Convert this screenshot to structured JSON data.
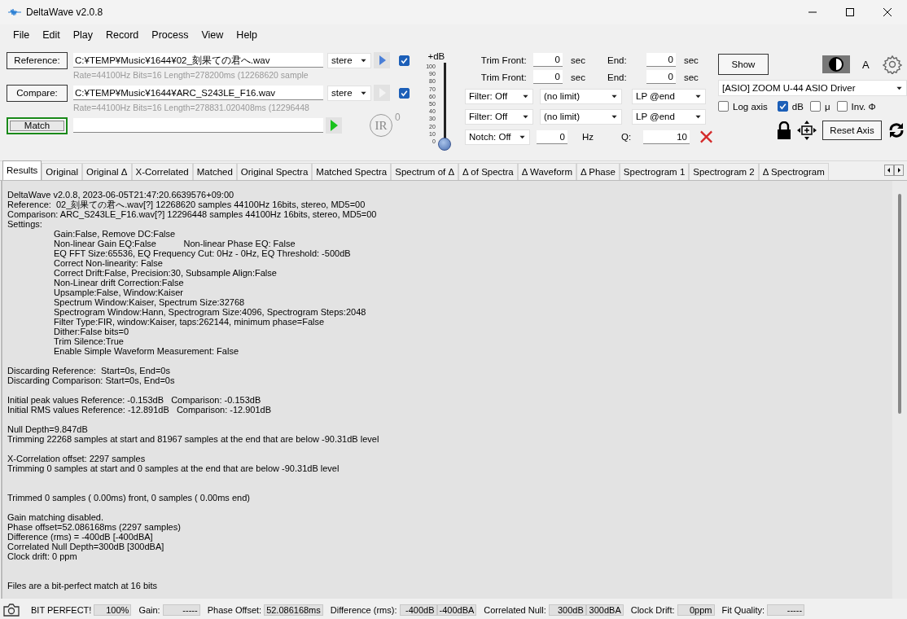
{
  "window": {
    "title": "DeltaWave v2.0.8"
  },
  "menu": [
    "File",
    "Edit",
    "Play",
    "Record",
    "Process",
    "View",
    "Help"
  ],
  "files": [
    {
      "button": "Reference:",
      "path": "C:¥TEMP¥Music¥1644¥02_刻果ての君へ.wav",
      "channel": "stere",
      "play_enabled": true,
      "checked": true,
      "info": "Rate=44100Hz Bits=16 Length=278200ms (12268620 sample"
    },
    {
      "button": "Compare:",
      "path": "C:¥TEMP¥Music¥1644¥ARC_S243LE_F16.wav",
      "channel": "stere",
      "play_enabled": false,
      "checked": true,
      "info": "Rate=44100Hz Bits=16 Length=278831.020408ms (12296448"
    }
  ],
  "match": {
    "button": "Match"
  },
  "ir": {
    "label": "IR",
    "count": "0"
  },
  "gain_slider": {
    "title": "+dB",
    "ticks": [
      "100",
      "90",
      "80",
      "70",
      "60",
      "50",
      "40",
      "30",
      "20",
      "10",
      "0"
    ],
    "level": 0
  },
  "trim_rows": [
    {
      "label": "Trim Front:",
      "front": "0",
      "unit": "sec",
      "end_label": "End:",
      "end": "0",
      "end_unit": "sec"
    },
    {
      "label": "Trim Front:",
      "front": "0",
      "unit": "sec",
      "end_label": "End:",
      "end": "0",
      "end_unit": "sec"
    }
  ],
  "filters": [
    {
      "type": "Filter: Off",
      "limit": "(no limit)",
      "mode": "LP @end"
    },
    {
      "type": "Filter: Off",
      "limit": "(no limit)",
      "mode": "LP @end"
    }
  ],
  "notch": {
    "type": "Notch: Off",
    "freq": "0",
    "unit": "Hz",
    "q_label": "Q:",
    "q": "10"
  },
  "show_button": "Show",
  "font_button": "A",
  "device": "[ASIO] ZOOM U-44 ASIO Driver",
  "options": [
    {
      "label": "Log axis",
      "checked": false
    },
    {
      "label": "dB",
      "checked": true
    },
    {
      "label": "μ",
      "checked": false
    },
    {
      "label": "Inv. Φ",
      "checked": false
    }
  ],
  "reset_axis": "Reset Axis",
  "tabs": [
    {
      "label": "Results",
      "selected": true
    },
    {
      "label": "Original",
      "selected": false
    },
    {
      "label": "Original Δ",
      "selected": false
    },
    {
      "label": "X-Correlated",
      "selected": false
    },
    {
      "label": "Matched",
      "selected": false
    },
    {
      "label": "Original Spectra",
      "selected": false
    },
    {
      "label": "Matched Spectra",
      "selected": false
    },
    {
      "label": "Spectrum of Δ",
      "selected": false
    },
    {
      "label": "Δ of Spectra",
      "selected": false
    },
    {
      "label": "Δ Waveform",
      "selected": false
    },
    {
      "label": "Δ Phase",
      "selected": false
    },
    {
      "label": "Spectrogram 1",
      "selected": false
    },
    {
      "label": "Spectrogram 2",
      "selected": false
    },
    {
      "label": "Δ Spectrogram",
      "selected": false
    }
  ],
  "results": [
    {
      "spaced": false,
      "lines": [
        "DeltaWave v2.0.8, 2023-06-05T21:47:20.6639576+09:00",
        "Reference:  02_刻果ての君へ.wav[?] 12268620 samples 44100Hz 16bits, stereo, MD5=00",
        "Comparison: ARC_S243LE_F16.wav[?] 12296448 samples 44100Hz 16bits, stereo, MD5=00",
        "Settings:"
      ],
      "children": [
        "Gain:False, Remove DC:False",
        "Non-linear Gain EQ:False           Non-linear Phase EQ: False",
        "EQ FFT Size:65536, EQ Frequency Cut: 0Hz - 0Hz, EQ Threshold: -500dB",
        "Correct Non-linearity: False",
        "Correct Drift:False, Precision:30, Subsample Align:False",
        "Non-Linear drift Correction:False",
        "Upsample:False, Window:Kaiser",
        "Spectrum Window:Kaiser, Spectrum Size:32768",
        "Spectrogram Window:Hann, Spectrogram Size:4096, Spectrogram Steps:2048",
        "Filter Type:FIR, window:Kaiser, taps:262144, minimum phase=False",
        "Dither:False bits=0",
        "Trim Silence:True",
        "Enable Simple Waveform Measurement: False"
      ]
    },
    {
      "spaced": false,
      "lines": [
        "Discarding Reference:  Start=0s, End=0s",
        "Discarding Comparison: Start=0s, End=0s"
      ]
    },
    {
      "spaced": false,
      "lines": [
        "Initial peak values Reference: -0.153dB   Comparison: -0.153dB",
        "Initial RMS values Reference: -12.891dB   Comparison: -12.901dB"
      ]
    },
    {
      "spaced": false,
      "lines": [
        "Null Depth=9.847dB",
        "Trimming 22268 samples at start and 81967 samples at the end that are below -90.31dB level"
      ]
    },
    {
      "spaced": false,
      "lines": [
        "X-Correlation offset: 2297 samples",
        "Trimming 0 samples at start and 0 samples at the end that are below -90.31dB level"
      ]
    },
    {
      "spaced": true,
      "lines": [
        "Trimmed 0 samples ( 0.00ms) front, 0 samples ( 0.00ms end)"
      ]
    },
    {
      "spaced": false,
      "lines": [
        "Gain matching disabled.",
        "Phase offset=52.086168ms (2297 samples)",
        "Difference (rms) = -400dB [-400dBA]",
        "Correlated Null Depth=300dB [300dBA]",
        "Clock drift: 0 ppm"
      ]
    },
    {
      "spaced": true,
      "lines": [
        "Files are a bit-perfect match at 16 bits"
      ]
    }
  ],
  "status": [
    {
      "label": "BIT PERFECT!",
      "values": [
        "100%"
      ]
    },
    {
      "label": "Gain:",
      "values": [
        "-----"
      ]
    },
    {
      "label": "Phase Offset:",
      "values": [
        "52.086168ms"
      ]
    },
    {
      "label": "Difference (rms):",
      "values": [
        "-400dB",
        "-400dBA"
      ]
    },
    {
      "label": "Correlated Null:",
      "values": [
        "300dB",
        "300dBA"
      ]
    },
    {
      "label": "Clock Drift:",
      "values": [
        "0ppm"
      ]
    },
    {
      "label": "Fit Quality:",
      "values": [
        "-----"
      ]
    }
  ]
}
